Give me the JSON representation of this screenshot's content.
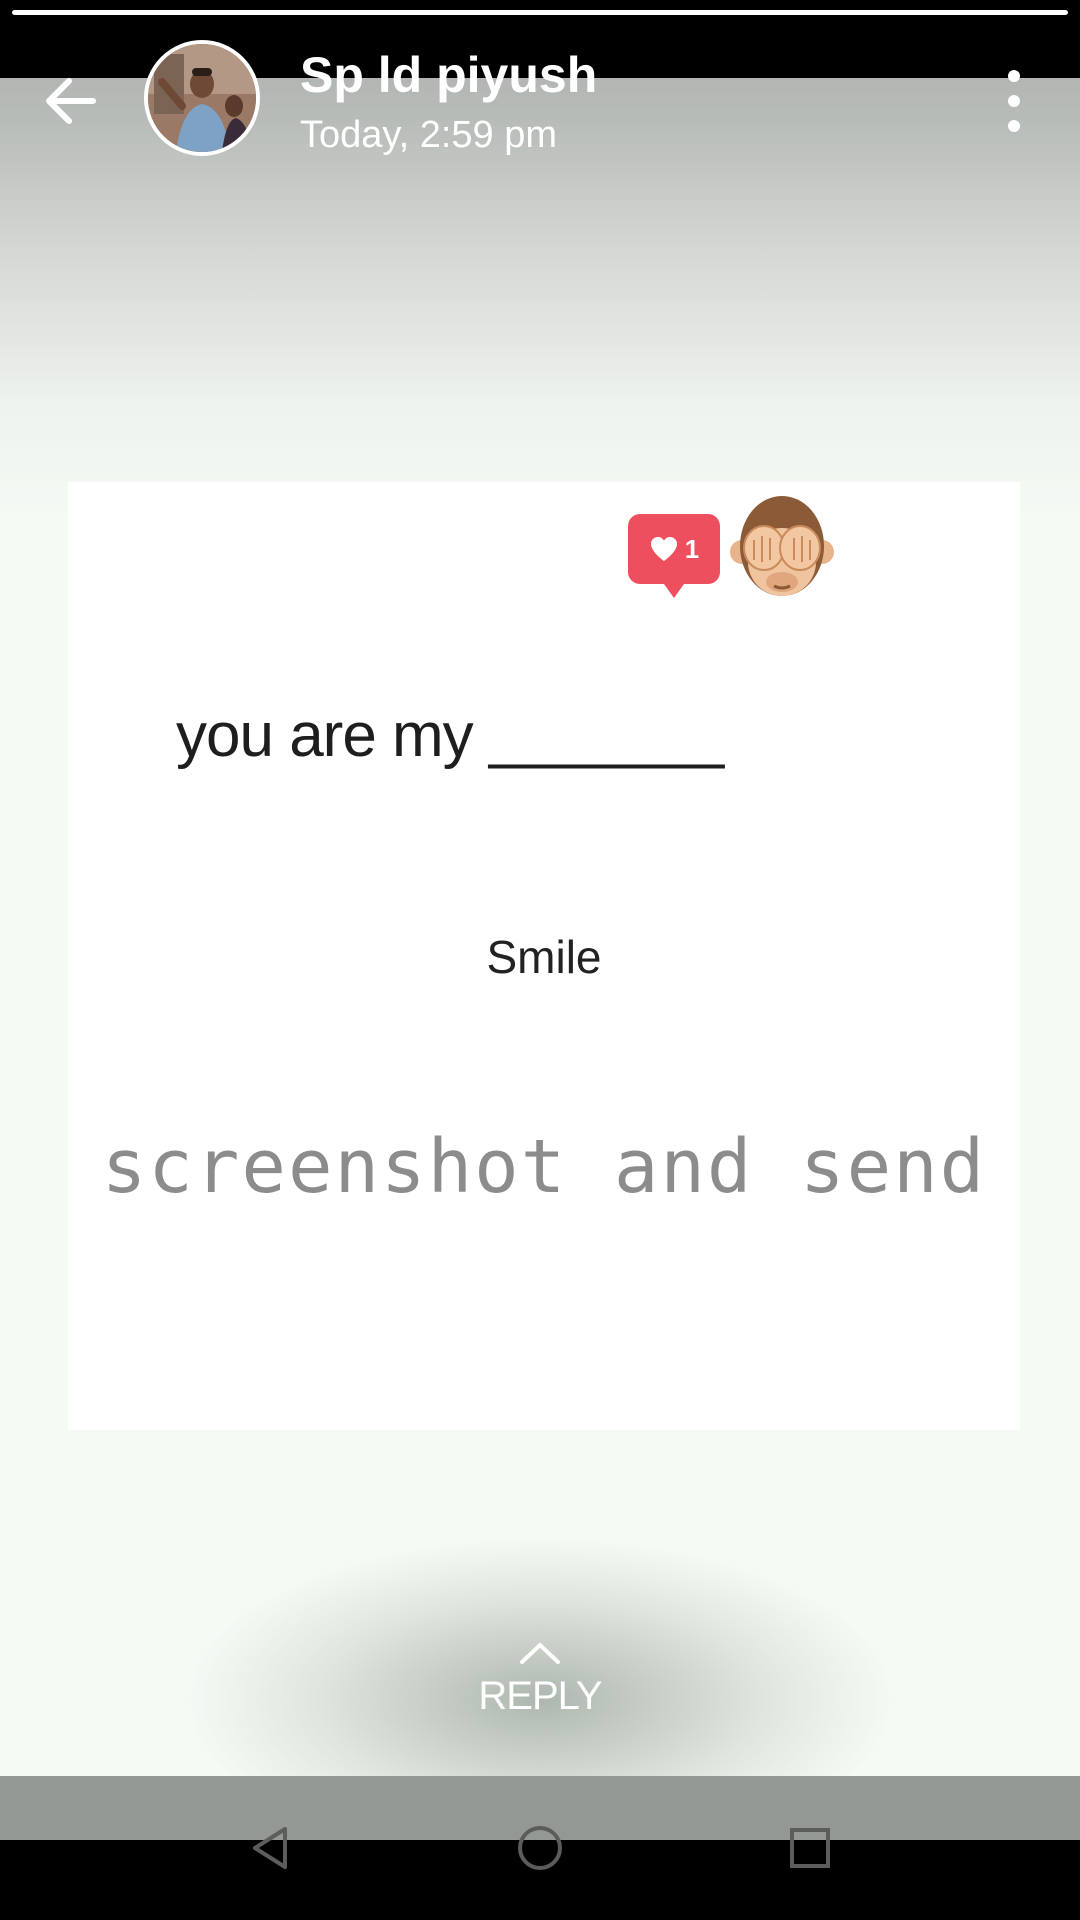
{
  "story_viewer": {
    "progress": 1.0,
    "sender_name": "Sp ld piyush",
    "timestamp": "Today, 2:59 pm"
  },
  "card": {
    "like_count": "1",
    "line1": "you are my _______",
    "line2": "Smile",
    "line3": "screenshot and send"
  },
  "reply": {
    "label": "REPLY"
  },
  "icons": {
    "back": "arrow-left-icon",
    "menu": "more-vertical-icon",
    "like": "heart-icon",
    "emoji": "see-no-evil-monkey-icon",
    "reply_chevron": "chevron-up-icon",
    "nav_back": "triangle-back-icon",
    "nav_home": "circle-home-icon",
    "nav_recents": "square-recents-icon"
  },
  "colors": {
    "like_badge": "#ee4f5e",
    "card_background": "#ffffff",
    "status_bar": "#000000"
  }
}
